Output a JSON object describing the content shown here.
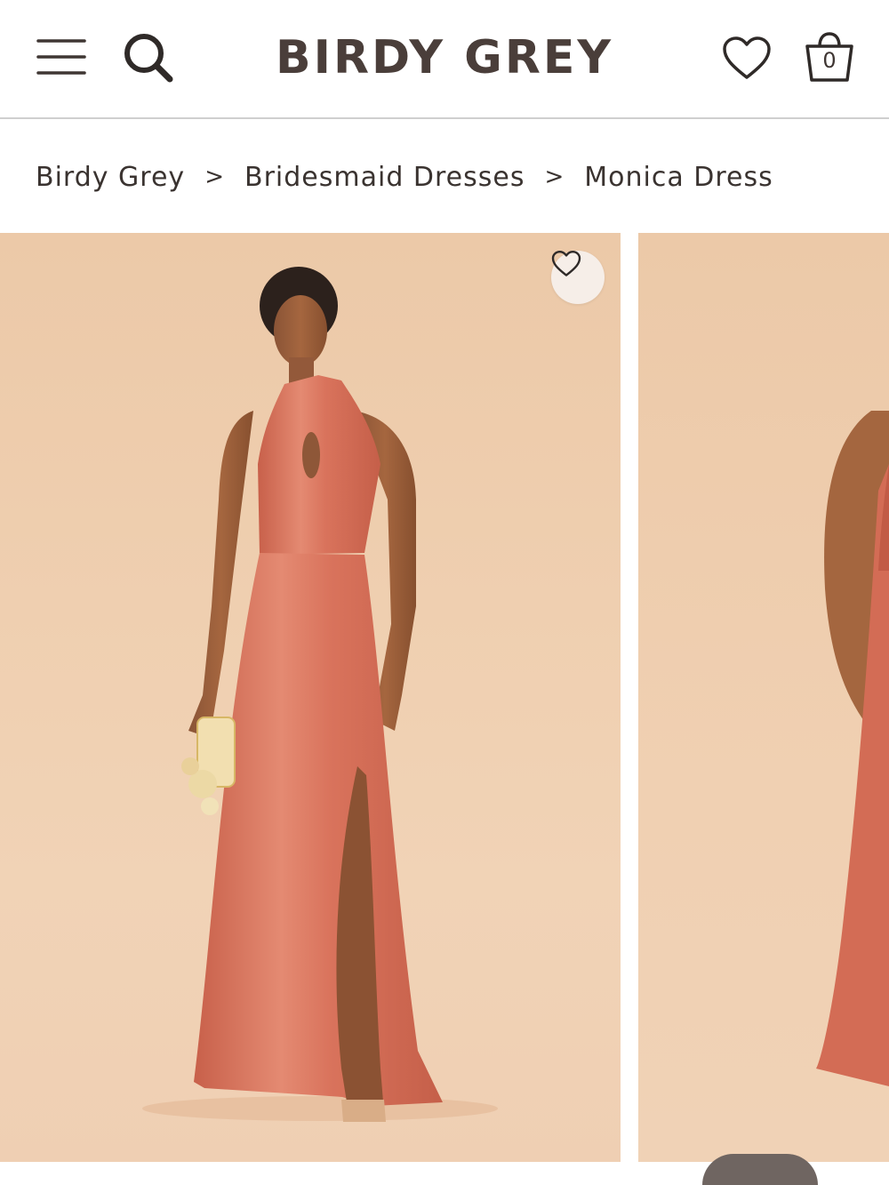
{
  "header": {
    "brand": "BIRDY GREY",
    "menu_icon": "hamburger-menu-icon",
    "search_icon": "search-icon",
    "favorites_icon": "heart-icon",
    "cart_icon": "shopping-bag-icon",
    "cart_count": "0"
  },
  "breadcrumb": {
    "items": [
      {
        "label": "Birdy Grey"
      },
      {
        "label": "Bridesmaid Dresses"
      },
      {
        "label": "Monica Dress"
      }
    ],
    "separator": ">"
  },
  "gallery": {
    "slides": [
      {
        "alt": "model-front",
        "favorite_icon": "heart-icon"
      },
      {
        "alt": "model-side"
      }
    ]
  },
  "colors": {
    "brand_text": "#4a3e3a",
    "background_peach": "#efcfb0",
    "dress_terracotta": "#d9735c"
  }
}
